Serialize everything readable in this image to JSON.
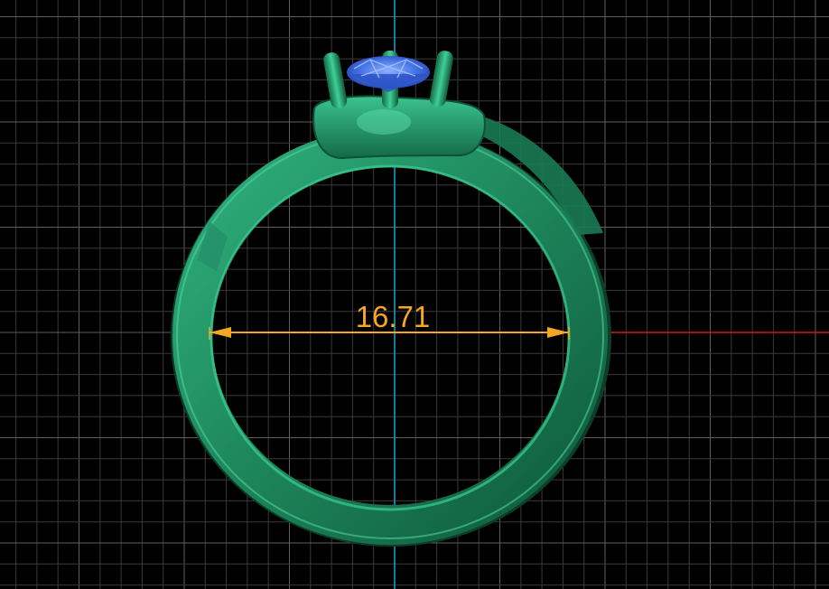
{
  "viewport": {
    "background_color": "#000000",
    "grid_minor_color": "#3a3a3a",
    "grid_major_color": "#5e5e5e",
    "grid_visible": true
  },
  "axes": {
    "vertical_axis_color": "#1ea5c8",
    "horizontal_axis_color": "#d0191c"
  },
  "ring": {
    "body_color": "#1f8a5e",
    "highlight_color": "#4fd1a0",
    "shadow_color": "#0b4a31"
  },
  "gemstone": {
    "color": "#3f6fe0",
    "edge_color": "#9ab8ff",
    "prong_count": 3
  },
  "measurement": {
    "label": "16.71",
    "value": 16.71,
    "color": "#f5a623",
    "arrow_style": "double-headed"
  }
}
